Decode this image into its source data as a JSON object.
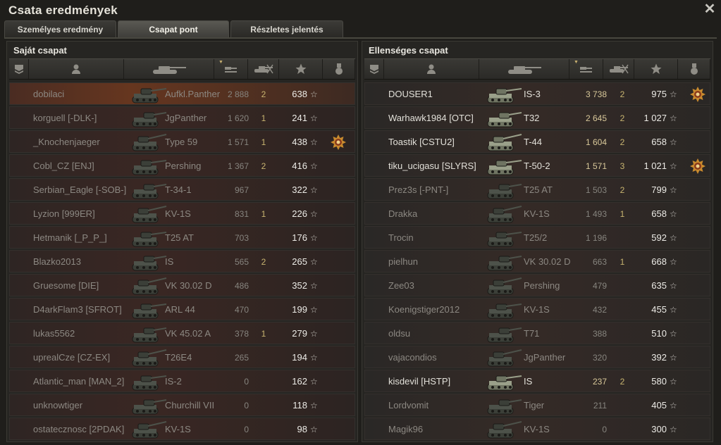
{
  "window": {
    "title": "Csata eredmények",
    "close_label": "✕"
  },
  "tabs": [
    {
      "label": "Személyes eredmény",
      "active": false
    },
    {
      "label": "Csapat pont",
      "active": true
    },
    {
      "label": "Részletes jelentés",
      "active": false
    }
  ],
  "columns": {
    "icons": [
      "rank-icon",
      "player-icon",
      "tank-icon",
      "damage-icon",
      "kills-icon",
      "xp-star-icon",
      "medal-icon"
    ]
  },
  "star_glyph": "☆",
  "own_team": {
    "title": "Saját csapat",
    "rows": [
      {
        "name": "dobilaci",
        "tank": "Aufkl.Panther",
        "damage": "2 888",
        "kills": "2",
        "xp": "638",
        "medal": false,
        "alive": false,
        "self": true
      },
      {
        "name": "korguell [-DLK-]",
        "tank": "JgPanther",
        "damage": "1 620",
        "kills": "1",
        "xp": "241",
        "medal": false,
        "alive": false
      },
      {
        "name": "_Knochenjaeger",
        "tank": "Type 59",
        "damage": "1 571",
        "kills": "1",
        "xp": "438",
        "medal": true,
        "alive": false
      },
      {
        "name": "Cobl_CZ [ENJ]",
        "tank": "Pershing",
        "damage": "1 367",
        "kills": "2",
        "xp": "416",
        "medal": false,
        "alive": false
      },
      {
        "name": "Serbian_Eagle [-SOB-]",
        "tank": "T-34-1",
        "damage": "967",
        "kills": "",
        "xp": "322",
        "medal": false,
        "alive": false
      },
      {
        "name": "Lyzion [999ER]",
        "tank": "KV-1S",
        "damage": "831",
        "kills": "1",
        "xp": "226",
        "medal": false,
        "alive": false
      },
      {
        "name": "Hetmanik [_P_P_]",
        "tank": "T25 AT",
        "damage": "703",
        "kills": "",
        "xp": "176",
        "medal": false,
        "alive": false
      },
      {
        "name": "Blazko2013",
        "tank": "IS",
        "damage": "565",
        "kills": "2",
        "xp": "265",
        "medal": false,
        "alive": false
      },
      {
        "name": "Gruesome [DIE]",
        "tank": "VK 30.02 D",
        "damage": "486",
        "kills": "",
        "xp": "352",
        "medal": false,
        "alive": false
      },
      {
        "name": "D4arkFlam3 [SFROT]",
        "tank": "ARL 44",
        "damage": "470",
        "kills": "",
        "xp": "199",
        "medal": false,
        "alive": false
      },
      {
        "name": "lukas5562",
        "tank": "VK 45.02 A",
        "damage": "378",
        "kills": "1",
        "xp": "279",
        "medal": false,
        "alive": false
      },
      {
        "name": "uprealCze [CZ-EX]",
        "tank": "T26E4",
        "damage": "265",
        "kills": "",
        "xp": "194",
        "medal": false,
        "alive": false
      },
      {
        "name": "Atlantic_man [MAN_2]",
        "tank": "IS-2",
        "damage": "0",
        "kills": "",
        "xp": "162",
        "medal": false,
        "alive": false
      },
      {
        "name": "unknowtiger",
        "tank": "Churchill VII",
        "damage": "0",
        "kills": "",
        "xp": "118",
        "medal": false,
        "alive": false
      },
      {
        "name": "ostatecznosc [2PDAK]",
        "tank": "KV-1S",
        "damage": "0",
        "kills": "",
        "xp": "98",
        "medal": false,
        "alive": false
      }
    ]
  },
  "enemy_team": {
    "title": "Ellenséges csapat",
    "rows": [
      {
        "name": "DOUSER1",
        "tank": "IS-3",
        "damage": "3 738",
        "kills": "2",
        "xp": "975",
        "medal": true,
        "alive": true
      },
      {
        "name": "Warhawk1984 [OTC]",
        "tank": "T32",
        "damage": "2 645",
        "kills": "2",
        "xp": "1 027",
        "medal": false,
        "alive": true
      },
      {
        "name": "Toastik [CSTU2]",
        "tank": "T-44",
        "damage": "1 604",
        "kills": "2",
        "xp": "658",
        "medal": false,
        "alive": true
      },
      {
        "name": "tiku_ucigasu [SLYRS]",
        "tank": "T-50-2",
        "damage": "1 571",
        "kills": "3",
        "xp": "1 021",
        "medal": true,
        "alive": true
      },
      {
        "name": "Prez3s [-PNT-]",
        "tank": "T25 AT",
        "damage": "1 503",
        "kills": "2",
        "xp": "799",
        "medal": false,
        "alive": false
      },
      {
        "name": "Drakka",
        "tank": "KV-1S",
        "damage": "1 493",
        "kills": "1",
        "xp": "658",
        "medal": false,
        "alive": false
      },
      {
        "name": "Trocin",
        "tank": "T25/2",
        "damage": "1 196",
        "kills": "",
        "xp": "592",
        "medal": false,
        "alive": false
      },
      {
        "name": "pielhun",
        "tank": "VK 30.02 D",
        "damage": "663",
        "kills": "1",
        "xp": "668",
        "medal": false,
        "alive": false
      },
      {
        "name": "Zee03",
        "tank": "Pershing",
        "damage": "479",
        "kills": "",
        "xp": "635",
        "medal": false,
        "alive": false
      },
      {
        "name": "Koenigstiger2012",
        "tank": "KV-1S",
        "damage": "432",
        "kills": "",
        "xp": "455",
        "medal": false,
        "alive": false
      },
      {
        "name": "oldsu",
        "tank": "T71",
        "damage": "388",
        "kills": "",
        "xp": "510",
        "medal": false,
        "alive": false
      },
      {
        "name": "vajacondios",
        "tank": "JgPanther",
        "damage": "320",
        "kills": "",
        "xp": "392",
        "medal": false,
        "alive": false
      },
      {
        "name": "kisdevil [HSTP]",
        "tank": "IS",
        "damage": "237",
        "kills": "2",
        "xp": "580",
        "medal": false,
        "alive": true
      },
      {
        "name": "Lordvomit",
        "tank": "Tiger",
        "damage": "211",
        "kills": "",
        "xp": "405",
        "medal": false,
        "alive": false
      },
      {
        "name": "Magik96",
        "tank": "KV-1S",
        "damage": "0",
        "kills": "",
        "xp": "300",
        "medal": false,
        "alive": false
      }
    ]
  }
}
